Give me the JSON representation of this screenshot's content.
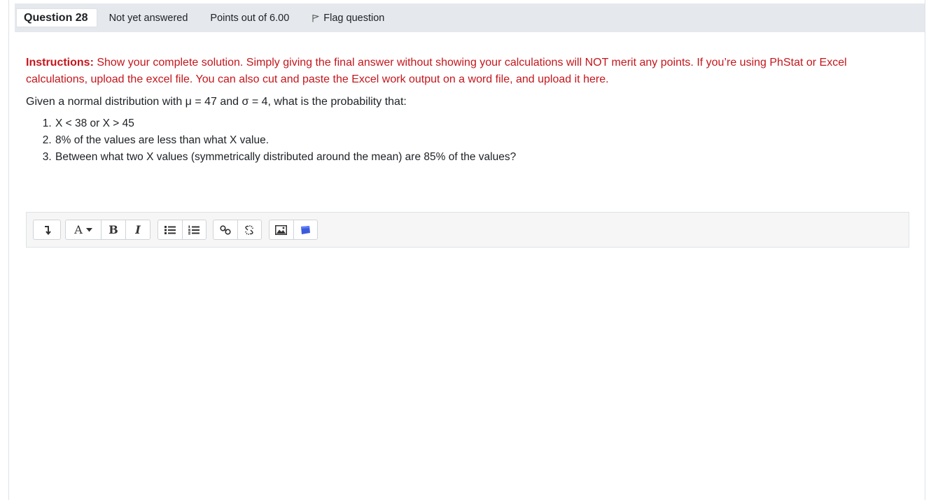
{
  "question": {
    "label": "Question 28",
    "state": "Not yet answered",
    "grade": "Points out of 6.00",
    "flag_label": "Flag question",
    "flag_icon": "flag-icon"
  },
  "instructions": {
    "label": "Instructions:",
    "text": " Show your complete solution. Simply giving the final answer without showing your calculations will NOT merit any points. If you’re using PhStat or Excel calculations, upload the excel file. You can also cut and paste the Excel work output on a word file, and upload it here.",
    "color": "#c4161c"
  },
  "given": "Given a normal distribution with μ = 47 and σ = 4, what is the probability that:",
  "items": [
    "X < 38 or X > 45",
    "8% of the values are less than what X value.",
    "Between what two X values (symmetrically distributed around the mean) are 85% of the values?"
  ],
  "toolbar": {
    "font_label": "A",
    "bold_label": "B",
    "italic_label": "I",
    "icons": [
      "collapse-icon",
      "font-color-icon",
      "bold-icon",
      "italic-icon",
      "unordered-list-icon",
      "ordered-list-icon",
      "link-icon",
      "unlink-icon",
      "image-icon",
      "media-icon"
    ]
  }
}
